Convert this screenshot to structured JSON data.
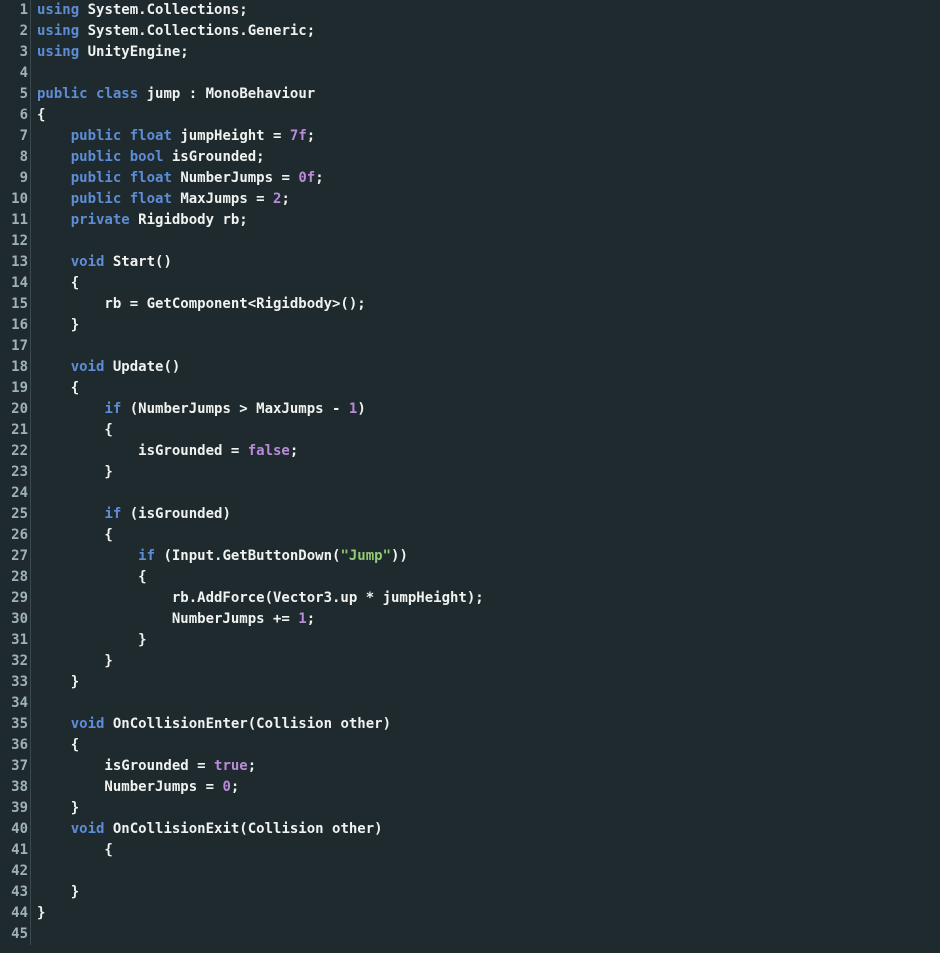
{
  "language": "csharp",
  "line_numbers": [
    1,
    2,
    3,
    4,
    5,
    6,
    7,
    8,
    9,
    10,
    11,
    12,
    13,
    14,
    15,
    16,
    17,
    18,
    19,
    20,
    21,
    22,
    23,
    24,
    25,
    26,
    27,
    28,
    29,
    30,
    31,
    32,
    33,
    34,
    35,
    36,
    37,
    38,
    39,
    40,
    41,
    42,
    43,
    44,
    45
  ],
  "code_lines": [
    [
      [
        "kw",
        "using"
      ],
      [
        "punc",
        " System.Collections;"
      ]
    ],
    [
      [
        "kw",
        "using"
      ],
      [
        "punc",
        " System.Collections.Generic;"
      ]
    ],
    [
      [
        "kw",
        "using"
      ],
      [
        "punc",
        " UnityEngine;"
      ]
    ],
    [
      [
        "",
        ""
      ]
    ],
    [
      [
        "kw",
        "public "
      ],
      [
        "kw",
        "class"
      ],
      [
        "punc",
        " jump : MonoBehaviour"
      ]
    ],
    [
      [
        "punc",
        "{"
      ]
    ],
    [
      [
        "punc",
        "    "
      ],
      [
        "kw",
        "public "
      ],
      [
        "kw",
        "float"
      ],
      [
        "punc",
        " jumpHeight = "
      ],
      [
        "num",
        "7f"
      ],
      [
        "punc",
        ";"
      ]
    ],
    [
      [
        "punc",
        "    "
      ],
      [
        "kw",
        "public "
      ],
      [
        "kw",
        "bool"
      ],
      [
        "punc",
        " isGrounded;"
      ]
    ],
    [
      [
        "punc",
        "    "
      ],
      [
        "kw",
        "public "
      ],
      [
        "kw",
        "float"
      ],
      [
        "punc",
        " NumberJumps = "
      ],
      [
        "num",
        "0f"
      ],
      [
        "punc",
        ";"
      ]
    ],
    [
      [
        "punc",
        "    "
      ],
      [
        "kw",
        "public "
      ],
      [
        "kw",
        "float"
      ],
      [
        "punc",
        " MaxJumps = "
      ],
      [
        "num",
        "2"
      ],
      [
        "punc",
        ";"
      ]
    ],
    [
      [
        "punc",
        "    "
      ],
      [
        "kw",
        "private"
      ],
      [
        "punc",
        " Rigidbody rb;"
      ]
    ],
    [
      [
        "",
        ""
      ]
    ],
    [
      [
        "punc",
        "    "
      ],
      [
        "kw",
        "void"
      ],
      [
        "punc",
        " Start()"
      ]
    ],
    [
      [
        "punc",
        "    {"
      ]
    ],
    [
      [
        "punc",
        "        rb = GetComponent<Rigidbody>();"
      ]
    ],
    [
      [
        "punc",
        "    }"
      ]
    ],
    [
      [
        "",
        ""
      ]
    ],
    [
      [
        "punc",
        "    "
      ],
      [
        "kw",
        "void"
      ],
      [
        "punc",
        " Update()"
      ]
    ],
    [
      [
        "punc",
        "    {"
      ]
    ],
    [
      [
        "punc",
        "        "
      ],
      [
        "kw",
        "if"
      ],
      [
        "punc",
        " (NumberJumps > MaxJumps - "
      ],
      [
        "num",
        "1"
      ],
      [
        "punc",
        ")"
      ]
    ],
    [
      [
        "punc",
        "        {"
      ]
    ],
    [
      [
        "punc",
        "            isGrounded = "
      ],
      [
        "bool",
        "false"
      ],
      [
        "punc",
        ";"
      ]
    ],
    [
      [
        "punc",
        "        }"
      ]
    ],
    [
      [
        "",
        ""
      ]
    ],
    [
      [
        "punc",
        "        "
      ],
      [
        "kw",
        "if"
      ],
      [
        "punc",
        " (isGrounded)"
      ]
    ],
    [
      [
        "punc",
        "        {"
      ]
    ],
    [
      [
        "punc",
        "            "
      ],
      [
        "kw",
        "if"
      ],
      [
        "punc",
        " (Input.GetButtonDown("
      ],
      [
        "str",
        "\"Jump\""
      ],
      [
        "punc",
        "))"
      ]
    ],
    [
      [
        "punc",
        "            {"
      ]
    ],
    [
      [
        "punc",
        "                rb.AddForce(Vector3.up * jumpHeight);"
      ]
    ],
    [
      [
        "punc",
        "                NumberJumps += "
      ],
      [
        "num",
        "1"
      ],
      [
        "punc",
        ";"
      ]
    ],
    [
      [
        "punc",
        "            }"
      ]
    ],
    [
      [
        "punc",
        "        }"
      ]
    ],
    [
      [
        "punc",
        "    }"
      ]
    ],
    [
      [
        "",
        ""
      ]
    ],
    [
      [
        "punc",
        "    "
      ],
      [
        "kw",
        "void"
      ],
      [
        "punc",
        " OnCollisionEnter(Collision other)"
      ]
    ],
    [
      [
        "punc",
        "    {"
      ]
    ],
    [
      [
        "punc",
        "        isGrounded = "
      ],
      [
        "bool",
        "true"
      ],
      [
        "punc",
        ";"
      ]
    ],
    [
      [
        "punc",
        "        NumberJumps = "
      ],
      [
        "num",
        "0"
      ],
      [
        "punc",
        ";"
      ]
    ],
    [
      [
        "punc",
        "    }"
      ]
    ],
    [
      [
        "punc",
        "    "
      ],
      [
        "kw",
        "void"
      ],
      [
        "punc",
        " OnCollisionExit(Collision other)"
      ]
    ],
    [
      [
        "punc",
        "        {"
      ]
    ],
    [
      [
        "",
        ""
      ]
    ],
    [
      [
        "punc",
        "    }"
      ]
    ],
    [
      [
        "punc",
        "}"
      ]
    ],
    [
      [
        "",
        ""
      ]
    ]
  ],
  "theme": {
    "background": "#1e2a2e",
    "foreground": "#f0f2f0",
    "keyword": "#5e8dd6",
    "number": "#b98cd9",
    "string": "#94c973",
    "boolean": "#b98cd9",
    "gutter_fg": "#9fb2b8"
  }
}
